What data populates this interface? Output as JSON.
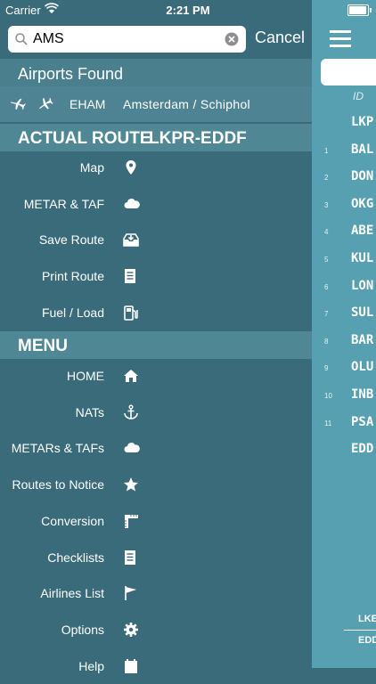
{
  "status": {
    "carrier": "Carrier",
    "time": "2:21 PM"
  },
  "search": {
    "value": "AMS",
    "cancel_label": "Cancel"
  },
  "airports_header": "Airports Found",
  "airport": {
    "code": "EHAM",
    "name": "Amsterdam / Schiphol"
  },
  "route_header": {
    "label": "ACTUAL ROUTE",
    "route": "LKPR-EDDF"
  },
  "route_items": [
    {
      "label": "Map",
      "icon": "map-pin-icon"
    },
    {
      "label": "METAR & TAF",
      "icon": "cloud-icon"
    },
    {
      "label": "Save Route",
      "icon": "save-tray-icon"
    },
    {
      "label": "Print Route",
      "icon": "document-icon"
    },
    {
      "label": "Fuel / Load",
      "icon": "fuel-pump-icon"
    }
  ],
  "menu_header": "MENU",
  "menu_items": [
    {
      "label": "HOME",
      "icon": "home-icon"
    },
    {
      "label": "NATs",
      "icon": "anchor-icon"
    },
    {
      "label": "METARs & TAFs",
      "icon": "cloud-icon"
    },
    {
      "label": "Routes to Notice",
      "icon": "star-icon"
    },
    {
      "label": "Conversion",
      "icon": "ruler-icon"
    },
    {
      "label": "Checklists",
      "icon": "checklist-icon"
    },
    {
      "label": "Airlines List",
      "icon": "flag-icon"
    },
    {
      "label": "Options",
      "icon": "gear-icon"
    },
    {
      "label": "Help",
      "icon": "calendar-icon"
    }
  ],
  "route_panel": {
    "id_label": "ID",
    "waypoints": [
      {
        "num": "",
        "code": "LKP"
      },
      {
        "num": "1",
        "code": "BAL"
      },
      {
        "num": "2",
        "code": "DON"
      },
      {
        "num": "3",
        "code": "OKG"
      },
      {
        "num": "4",
        "code": "ABE"
      },
      {
        "num": "5",
        "code": "KUL"
      },
      {
        "num": "6",
        "code": "LON"
      },
      {
        "num": "7",
        "code": "SUL"
      },
      {
        "num": "8",
        "code": "BAR"
      },
      {
        "num": "9",
        "code": "OLU"
      },
      {
        "num": "10",
        "code": "INB"
      },
      {
        "num": "11",
        "code": "PSA"
      },
      {
        "num": "",
        "code": "EDD"
      }
    ],
    "footer_from": "LKE",
    "footer_to": "EDD"
  },
  "colors": {
    "sidebar": "#3a6b7a",
    "header": "#4f8795",
    "panel": "#56a0b2"
  }
}
